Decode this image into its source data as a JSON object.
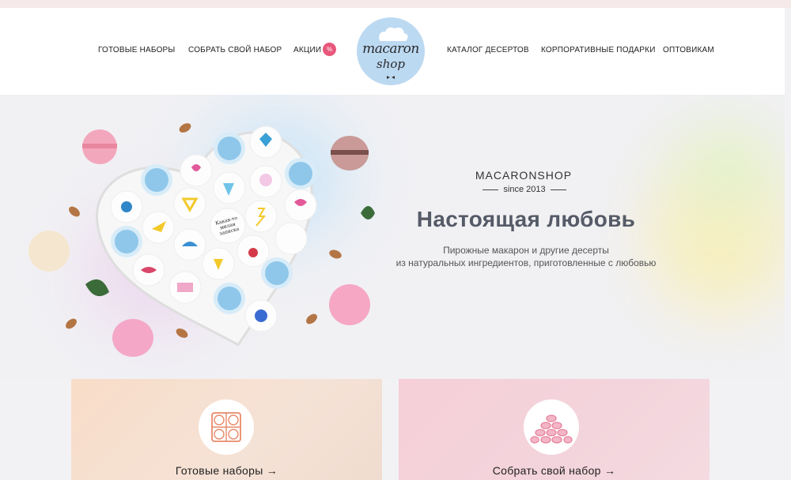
{
  "header": {
    "nav_left": [
      "ГОТОВЫЕ НАБОРЫ",
      "СОБРАТЬ СВОЙ НАБОР",
      "АКЦИИ"
    ],
    "sale_badge": "%",
    "logo": {
      "line1": "macaron",
      "line2": "shop"
    },
    "nav_right": [
      "КАТАЛОГ ДЕСЕРТОВ",
      "КОРПОРАТИВНЫЕ ПОДАРКИ",
      "ОПТОВИКАМ"
    ]
  },
  "hero": {
    "brand": "MACARONSHOP",
    "since": "since 2013",
    "headline": "Настоящая любовь",
    "subtitle_line1": "Пирожные макарон и другие десерты",
    "subtitle_line2": "из натуральных ингредиентов, приготовленные с любовью",
    "box_macaron_text": "Какая-то милая записка"
  },
  "cards": [
    {
      "label": "Готовые наборы",
      "arrow": "→",
      "icon": "macaron-box-icon"
    },
    {
      "label": "Собрать свой набор",
      "arrow": "→",
      "icon": "macaron-stack-icon"
    }
  ],
  "colors": {
    "accent_pink": "#e8577b",
    "logo_blue": "#bcd9f2",
    "card_peach": "#f8ddc8",
    "card_pink": "#f6cfd8"
  }
}
